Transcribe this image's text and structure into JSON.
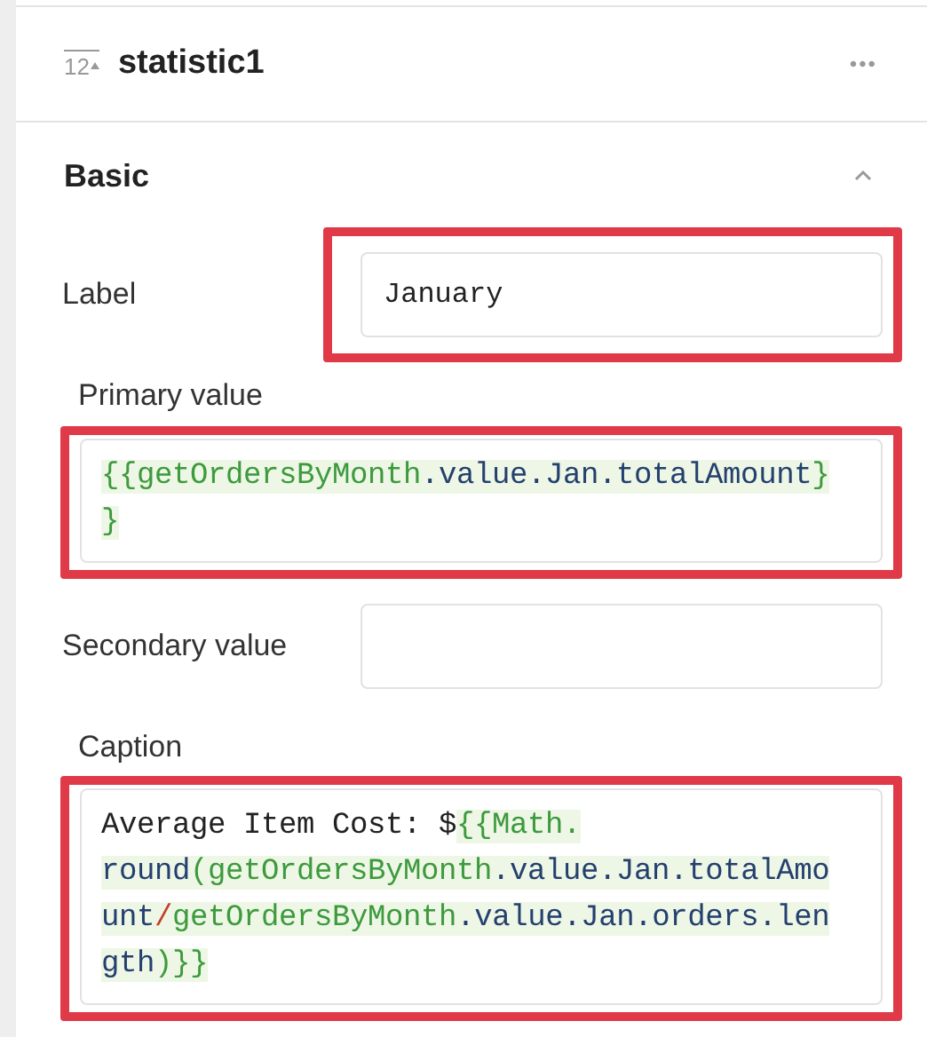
{
  "header": {
    "icon_text": "12",
    "title": "statistic1",
    "menu": "•••"
  },
  "section": {
    "title": "Basic",
    "expanded": true
  },
  "fields": [
    {
      "kind": "inline",
      "label": "Label",
      "value": "January",
      "highlighted": true
    },
    {
      "kind": "code",
      "label": "Primary value",
      "highlighted": true,
      "lines": [
        [
          {
            "kind": "tpl",
            "text": "{{getOrdersByMonth"
          },
          {
            "kind": "prop",
            "text": ".value.Jan.totalAmount"
          },
          {
            "kind": "tpl",
            "text": "}"
          }
        ],
        [
          {
            "kind": "tpl",
            "text": "}"
          }
        ]
      ]
    },
    {
      "kind": "inline",
      "label": "Secondary value",
      "highlighted": false
    },
    {
      "kind": "code",
      "label": "Caption",
      "highlighted": true,
      "lines": [
        [
          {
            "kind": "text",
            "text": "Average Item Cost: $"
          },
          {
            "kind": "tpl",
            "text": "{{Math."
          }
        ],
        [
          {
            "kind": "prop",
            "text": "round"
          },
          {
            "kind": "tpl",
            "text": "(getOrdersByMonth"
          },
          {
            "kind": "prop",
            "text": ".value.Jan.totalAmo"
          }
        ],
        [
          {
            "kind": "prop",
            "text": "unt"
          },
          {
            "kind": "op",
            "text": "/"
          },
          {
            "kind": "tpl",
            "text": "getOrdersByMonth"
          },
          {
            "kind": "prop",
            "text": ".value.Jan.orders.len"
          }
        ],
        [
          {
            "kind": "prop",
            "text": "gth"
          },
          {
            "kind": "tpl",
            "text": ")}}"
          }
        ]
      ]
    }
  ]
}
